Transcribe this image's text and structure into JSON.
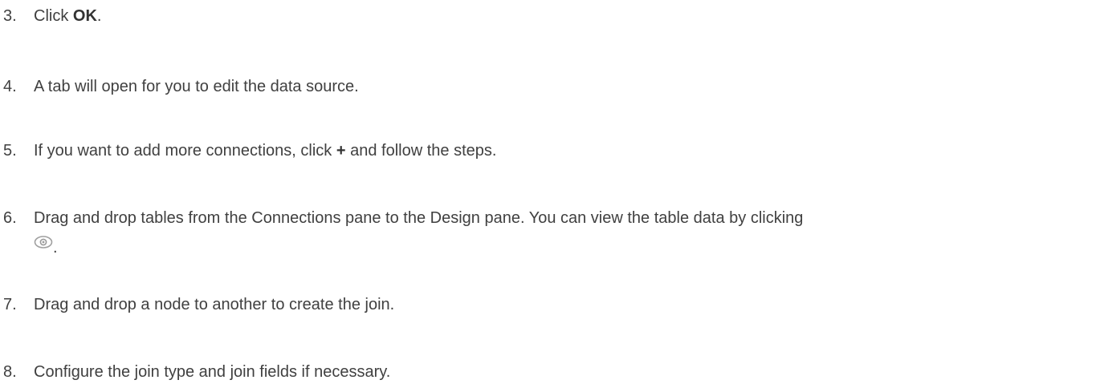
{
  "steps": [
    {
      "number": "3.",
      "parts": [
        "Click ",
        "OK",
        "."
      ]
    },
    {
      "number": "4.",
      "text": "A tab will open for you to edit the data source."
    },
    {
      "number": "5.",
      "parts": [
        "If you want to add more connections, click ",
        "+",
        " and follow the steps."
      ]
    },
    {
      "number": "6.",
      "text": "Drag and drop tables from the Connections pane to the Design pane. You can view the table data by clicking",
      "after_icon": ".",
      "icon": "eye-icon"
    },
    {
      "number": "7.",
      "text": "Drag and drop a node to another to create the join."
    },
    {
      "number": "8.",
      "text": "Configure the join type and join fields if necessary."
    }
  ]
}
